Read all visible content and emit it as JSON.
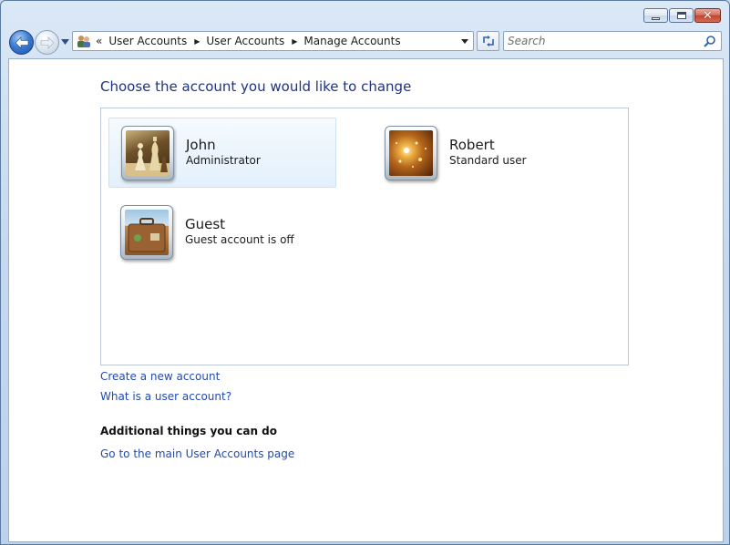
{
  "window": {
    "caption_buttons": [
      "minimize",
      "maximize",
      "close"
    ]
  },
  "nav": {
    "address_overflow": "«",
    "breadcrumbs": [
      "User Accounts",
      "User Accounts",
      "Manage Accounts"
    ],
    "search_placeholder": "Search"
  },
  "main": {
    "heading": "Choose the account you would like to change",
    "accounts": [
      {
        "name": "John",
        "type": "Administrator",
        "picture": "chess-pieces",
        "selected": true
      },
      {
        "name": "Robert",
        "type": "Standard user",
        "picture": "sparkles",
        "selected": false
      },
      {
        "name": "Guest",
        "type": "Guest account is off",
        "picture": "suitcase",
        "selected": false
      }
    ],
    "links": {
      "create_account": "Create a new account",
      "what_is_account": "What is a user account?"
    },
    "additional": {
      "heading": "Additional things you can do",
      "main_page_link": "Go to the main User Accounts page"
    }
  },
  "colors": {
    "heading": "#1e3287",
    "link": "#1f4bb0",
    "selection": "#e3f0fc"
  }
}
